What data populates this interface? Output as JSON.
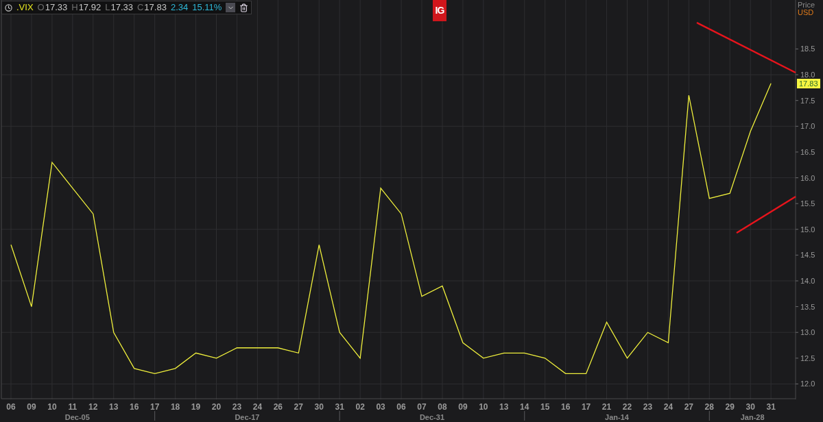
{
  "toolbar": {
    "quotes": [
      {
        "label": "O",
        "value": "17.33"
      },
      {
        "label": "H",
        "value": "17.92"
      },
      {
        "label": "L",
        "value": "17.33"
      },
      {
        "label": "C",
        "value": "17.83"
      }
    ],
    "change": "2.34",
    "change_pct": "15.11%"
  },
  "logo": "IG",
  "axis": {
    "title": "Price",
    "unit": "USD",
    "current_price": "17.83"
  },
  "periods": [
    {
      "label": "Dec-05"
    },
    {
      "label": "Dec-17"
    },
    {
      "label": "Dec-31"
    },
    {
      "label": "Jan-14"
    },
    {
      "label": "Jan-28"
    }
  ],
  "chart_data": {
    "type": "line",
    "grid": true,
    "categories": [
      "06",
      "09",
      "10",
      "11",
      "12",
      "13",
      "16",
      "17",
      "18",
      "19",
      "20",
      "23",
      "24",
      "26",
      "27",
      "30",
      "31",
      "02",
      "03",
      "06",
      "07",
      "08",
      "09",
      "10",
      "13",
      "14",
      "15",
      "16",
      "17",
      "21",
      "22",
      "23",
      "24",
      "27",
      "28",
      "29",
      "30",
      "31"
    ],
    "ylim": [
      11.7,
      19.45
    ],
    "yticks": [
      {
        "value": 12,
        "label": "12.0"
      },
      {
        "value": 12.5,
        "label": "12.5"
      },
      {
        "value": 13,
        "label": "13.0"
      },
      {
        "value": 13.5,
        "label": "13.5"
      },
      {
        "value": 14,
        "label": "14.0"
      },
      {
        "value": 14.5,
        "label": "14.5"
      },
      {
        "value": 15,
        "label": "15.0"
      },
      {
        "value": 15.5,
        "label": "15.5"
      },
      {
        "value": 16,
        "label": "16.0"
      },
      {
        "value": 16.5,
        "label": "16.5"
      },
      {
        "value": 17,
        "label": "17.0"
      },
      {
        "value": 17.5,
        "label": "17.5"
      },
      {
        "value": 18,
        "label": "18.0"
      },
      {
        "value": 18.5,
        "label": "18.5"
      }
    ],
    "series": [
      {
        "name": ".VIX",
        "color": "#f0f03c",
        "values": [
          14.7,
          13.5,
          16.3,
          15.8,
          15.3,
          13.0,
          12.3,
          12.2,
          12.3,
          12.6,
          12.5,
          12.7,
          12.7,
          12.7,
          12.6,
          14.7,
          13.0,
          12.5,
          15.8,
          15.3,
          13.7,
          13.9,
          12.8,
          12.5,
          12.6,
          12.6,
          12.5,
          12.2,
          12.2,
          13.2,
          12.5,
          13.0,
          12.8,
          17.6,
          15.6,
          15.7,
          16.9,
          17.83
        ]
      }
    ]
  }
}
